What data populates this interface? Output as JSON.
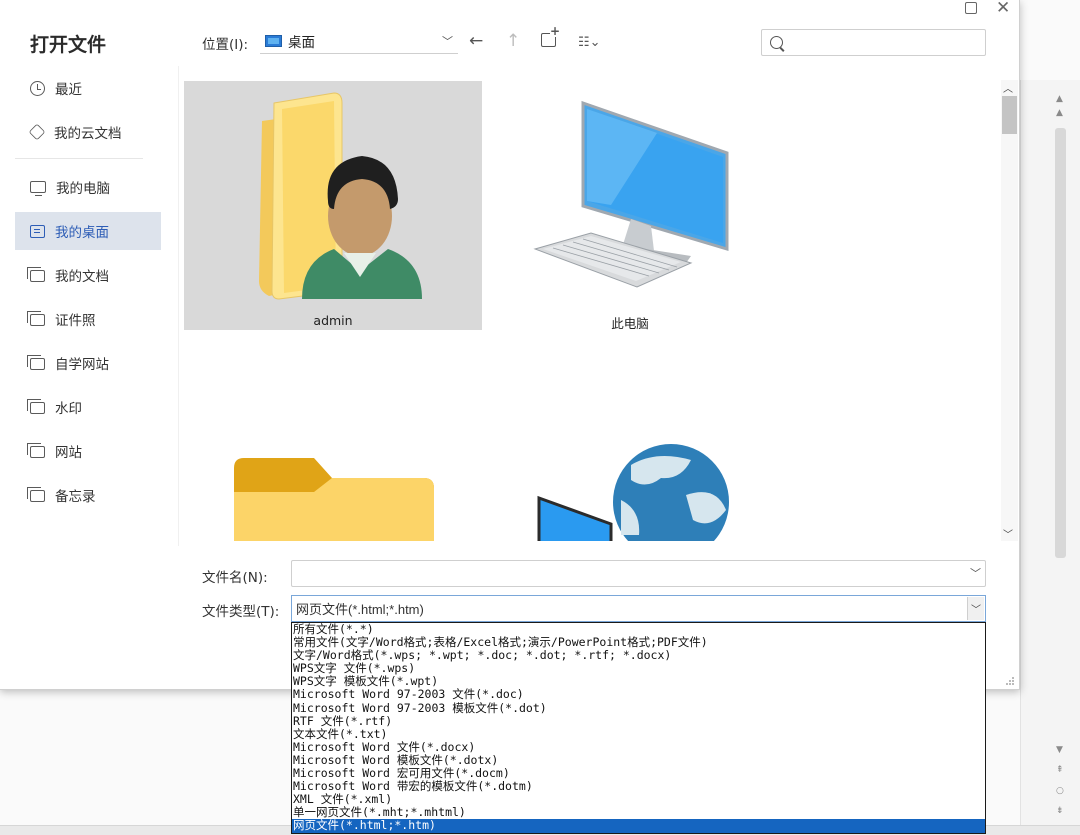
{
  "dialog": {
    "title": "打开文件",
    "close_glyph": "✕"
  },
  "sidebar": {
    "items": [
      {
        "label": "最近",
        "icon": "clock-icon"
      },
      {
        "label": "我的云文档",
        "icon": "cube-icon"
      },
      {
        "label": "我的电脑",
        "icon": "monitor-icon"
      },
      {
        "label": "我的桌面",
        "icon": "desktop-icon",
        "active": true
      },
      {
        "label": "我的文档",
        "icon": "folder-icon"
      },
      {
        "label": "证件照",
        "icon": "folder-icon"
      },
      {
        "label": "自学网站",
        "icon": "folder-icon"
      },
      {
        "label": "水印",
        "icon": "folder-icon"
      },
      {
        "label": "网站",
        "icon": "folder-icon"
      },
      {
        "label": "备忘录",
        "icon": "folder-icon"
      }
    ]
  },
  "location": {
    "label": "位置(I):",
    "value": "桌面"
  },
  "toolbar": {
    "back_glyph": "←",
    "up_glyph": "↑",
    "view_glyph": "☷⌄"
  },
  "search": {
    "placeholder": ""
  },
  "files": [
    {
      "label": "admin",
      "kind": "user-folder",
      "selected": true
    },
    {
      "label": "此电脑",
      "kind": "computer"
    },
    {
      "label": "",
      "kind": "folder"
    },
    {
      "label": "",
      "kind": "network"
    }
  ],
  "filename": {
    "label": "文件名(N):",
    "value": ""
  },
  "filetype": {
    "label": "文件类型(T):",
    "value": "网页文件(*.html;*.htm)",
    "options": [
      "所有文件(*.*)",
      "常用文件(文字/Word格式;表格/Excel格式;演示/PowerPoint格式;PDF文件)",
      "文字/Word格式(*.wps; *.wpt; *.doc; *.dot; *.rtf; *.docx)",
      "WPS文字 文件(*.wps)",
      "WPS文字 模板文件(*.wpt)",
      "Microsoft Word 97-2003 文件(*.doc)",
      "Microsoft Word 97-2003 模板文件(*.dot)",
      "RTF 文件(*.rtf)",
      "文本文件(*.txt)",
      "Microsoft Word 文件(*.docx)",
      "Microsoft Word 模板文件(*.dotx)",
      "Microsoft Word 宏可用文件(*.docm)",
      "Microsoft Word 带宏的模板文件(*.dotm)",
      "XML 文件(*.xml)",
      "单一网页文件(*.mht;*.mhtml)",
      "网页文件(*.html;*.htm)"
    ],
    "selected_index": 15
  },
  "colors": {
    "accent": "#2d5db6",
    "selection": "#1565c0",
    "tile_selected": "#d9d9d9"
  }
}
